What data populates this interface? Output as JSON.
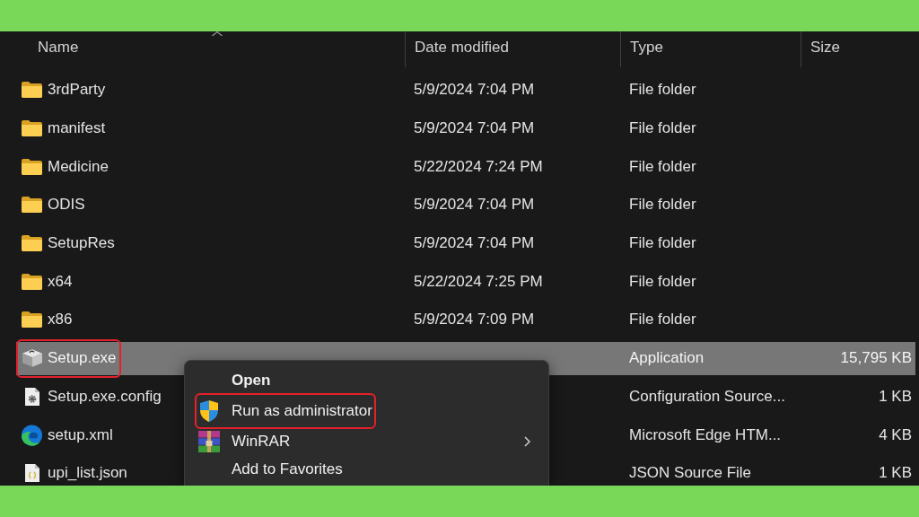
{
  "columns": [
    {
      "label": "Name",
      "sorted": true
    },
    {
      "label": "Date modified",
      "sorted": false
    },
    {
      "label": "Type",
      "sorted": false
    },
    {
      "label": "Size",
      "sorted": false
    }
  ],
  "rows": [
    {
      "kind": "folder",
      "name": "3rdParty",
      "date": "5/9/2024 7:04 PM",
      "type": "File folder",
      "selected": false,
      "highlighted": false
    },
    {
      "kind": "folder",
      "name": "manifest",
      "date": "5/9/2024 7:04 PM",
      "type": "File folder",
      "selected": false,
      "highlighted": false
    },
    {
      "kind": "folder",
      "name": "Medicine",
      "date": "5/22/2024 7:24 PM",
      "type": "File folder",
      "selected": false,
      "highlighted": false
    },
    {
      "kind": "folder",
      "name": "ODIS",
      "date": "5/9/2024 7:04 PM",
      "type": "File folder",
      "selected": false,
      "highlighted": false
    },
    {
      "kind": "folder",
      "name": "SetupRes",
      "date": "5/9/2024 7:04 PM",
      "type": "File folder",
      "selected": false,
      "highlighted": false
    },
    {
      "kind": "folder",
      "name": "x64",
      "date": "5/22/2024 7:25 PM",
      "type": "File folder",
      "selected": false,
      "highlighted": false
    },
    {
      "kind": "folder",
      "name": "x86",
      "date": "5/9/2024 7:09 PM",
      "type": "File folder",
      "selected": false,
      "highlighted": false
    },
    {
      "kind": "installer",
      "name": "Setup.exe",
      "type": "Application",
      "size": "15,795 KB",
      "selected": true,
      "highlighted": true
    },
    {
      "kind": "config",
      "name": "Setup.exe.config",
      "type": "Configuration Source...",
      "size": "1 KB",
      "selected": false,
      "highlighted": false
    },
    {
      "kind": "webpage",
      "name": "setup.xml",
      "type": "Microsoft Edge HTM...",
      "size": "4 KB",
      "selected": false,
      "highlighted": false
    },
    {
      "kind": "json",
      "name": "upi_list.json",
      "type": "JSON Source File",
      "size": "1 KB",
      "selected": false,
      "highlighted": false
    }
  ],
  "context_menu": {
    "items": [
      {
        "kind": "plain",
        "label": "Open",
        "default": true,
        "submenu": false,
        "highlighted": false
      },
      {
        "kind": "shield",
        "label": "Run as administrator",
        "default": false,
        "submenu": false,
        "highlighted": true
      },
      {
        "kind": "archive",
        "label": "WinRAR",
        "default": false,
        "submenu": true,
        "highlighted": false
      },
      {
        "kind": "plain",
        "label": "Add to Favorites",
        "default": false,
        "submenu": false,
        "highlighted": false
      }
    ]
  }
}
